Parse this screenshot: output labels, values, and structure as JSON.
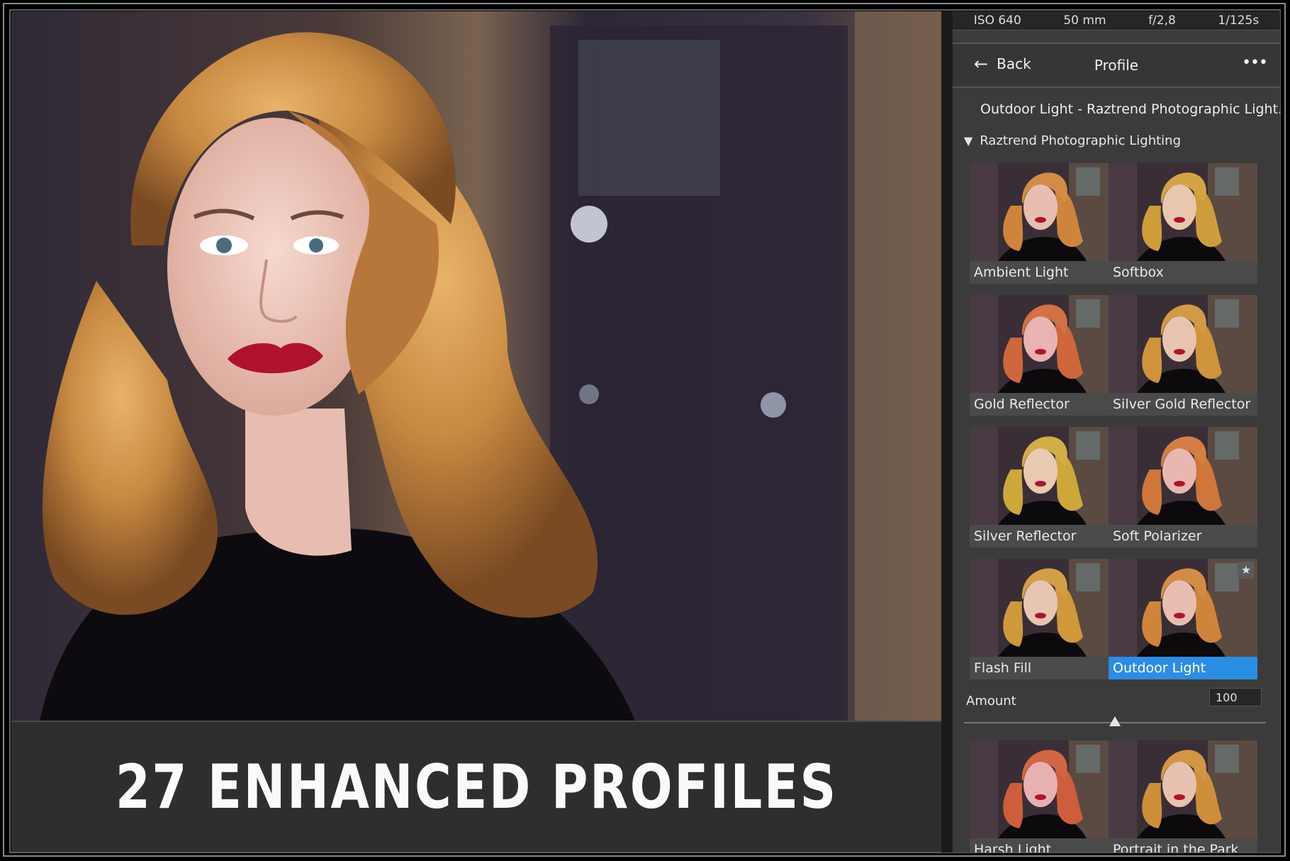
{
  "caption": "27 ENHANCED PROFILES",
  "exif": [
    "ISO 640",
    "50 mm",
    "f/2,8",
    "1/125s"
  ],
  "nav": {
    "back_label": "Back",
    "title": "Profile",
    "more": "•••",
    "back_arrow": "←"
  },
  "profile_select": "Outdoor Light - Raztrend Photographic Light...",
  "group": {
    "toggle": "▼",
    "name": "Raztrend Photographic Lighting"
  },
  "profiles": [
    "Ambient Light",
    "Softbox",
    "Gold Reflector",
    "Silver Gold Reflector",
    "Silver Reflector",
    "Soft Polarizer",
    "Flash Fill",
    "Outdoor Light",
    "Harsh Light",
    "Portrait in the Park"
  ],
  "selected_profile": "Outdoor Light",
  "favorite_icon": "★",
  "amount": {
    "label": "Amount",
    "value": "100",
    "fraction": 0.5
  },
  "colors": {
    "accent": "#2b8de3",
    "panel": "#3b3b3b",
    "hair": "#c98a42",
    "lips": "#b0122e"
  }
}
